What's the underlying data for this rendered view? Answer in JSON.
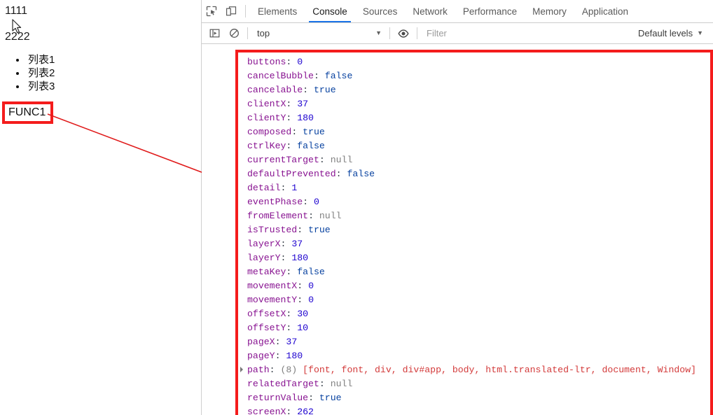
{
  "page": {
    "text_top": "1111",
    "text_second": "2222",
    "list_items": [
      "列表1",
      "列表2",
      "列表3"
    ],
    "func_button_label": "FUNC1"
  },
  "devtools": {
    "icons": {
      "inspect": "inspect-element-icon",
      "device": "device-toolbar-icon",
      "sidebar": "console-sidebar-icon",
      "clear": "clear-console-icon",
      "eye": "live-expression-eye-icon"
    },
    "tabs": [
      {
        "label": "Elements",
        "active": false
      },
      {
        "label": "Console",
        "active": true
      },
      {
        "label": "Sources",
        "active": false
      },
      {
        "label": "Network",
        "active": false
      },
      {
        "label": "Performance",
        "active": false
      },
      {
        "label": "Memory",
        "active": false
      },
      {
        "label": "Application",
        "active": false
      }
    ],
    "filterbar": {
      "context": "top",
      "filter_value": "",
      "filter_placeholder": "Filter",
      "levels": "Default levels"
    },
    "accent_color": "#1a73e8",
    "annotation_color": "#f41c1c"
  },
  "console_lines": [
    {
      "key": "buttons",
      "value": "0",
      "type": "num",
      "expandable": false
    },
    {
      "key": "cancelBubble",
      "value": "false",
      "type": "bool",
      "expandable": false
    },
    {
      "key": "cancelable",
      "value": "true",
      "type": "bool",
      "expandable": false
    },
    {
      "key": "clientX",
      "value": "37",
      "type": "num",
      "expandable": false
    },
    {
      "key": "clientY",
      "value": "180",
      "type": "num",
      "expandable": false
    },
    {
      "key": "composed",
      "value": "true",
      "type": "bool",
      "expandable": false
    },
    {
      "key": "ctrlKey",
      "value": "false",
      "type": "bool",
      "expandable": false
    },
    {
      "key": "currentTarget",
      "value": "null",
      "type": "null",
      "expandable": false
    },
    {
      "key": "defaultPrevented",
      "value": "false",
      "type": "bool",
      "expandable": false
    },
    {
      "key": "detail",
      "value": "1",
      "type": "num",
      "expandable": false
    },
    {
      "key": "eventPhase",
      "value": "0",
      "type": "num",
      "expandable": false
    },
    {
      "key": "fromElement",
      "value": "null",
      "type": "null",
      "expandable": false
    },
    {
      "key": "isTrusted",
      "value": "true",
      "type": "bool",
      "expandable": false
    },
    {
      "key": "layerX",
      "value": "37",
      "type": "num",
      "expandable": false
    },
    {
      "key": "layerY",
      "value": "180",
      "type": "num",
      "expandable": false
    },
    {
      "key": "metaKey",
      "value": "false",
      "type": "bool",
      "expandable": false
    },
    {
      "key": "movementX",
      "value": "0",
      "type": "num",
      "expandable": false
    },
    {
      "key": "movementY",
      "value": "0",
      "type": "num",
      "expandable": false
    },
    {
      "key": "offsetX",
      "value": "30",
      "type": "num",
      "expandable": false
    },
    {
      "key": "offsetY",
      "value": "10",
      "type": "num",
      "expandable": false
    },
    {
      "key": "pageX",
      "value": "37",
      "type": "num",
      "expandable": false
    },
    {
      "key": "pageY",
      "value": "180",
      "type": "num",
      "expandable": false
    },
    {
      "key": "path",
      "value": "(8) [font, font, div, div#app, body, html.translated-ltr, document, Window]",
      "type": "array",
      "expandable": true
    },
    {
      "key": "relatedTarget",
      "value": "null",
      "type": "null",
      "expandable": false
    },
    {
      "key": "returnValue",
      "value": "true",
      "type": "bool",
      "expandable": false
    },
    {
      "key": "screenX",
      "value": "262",
      "type": "num",
      "expandable": false
    }
  ]
}
